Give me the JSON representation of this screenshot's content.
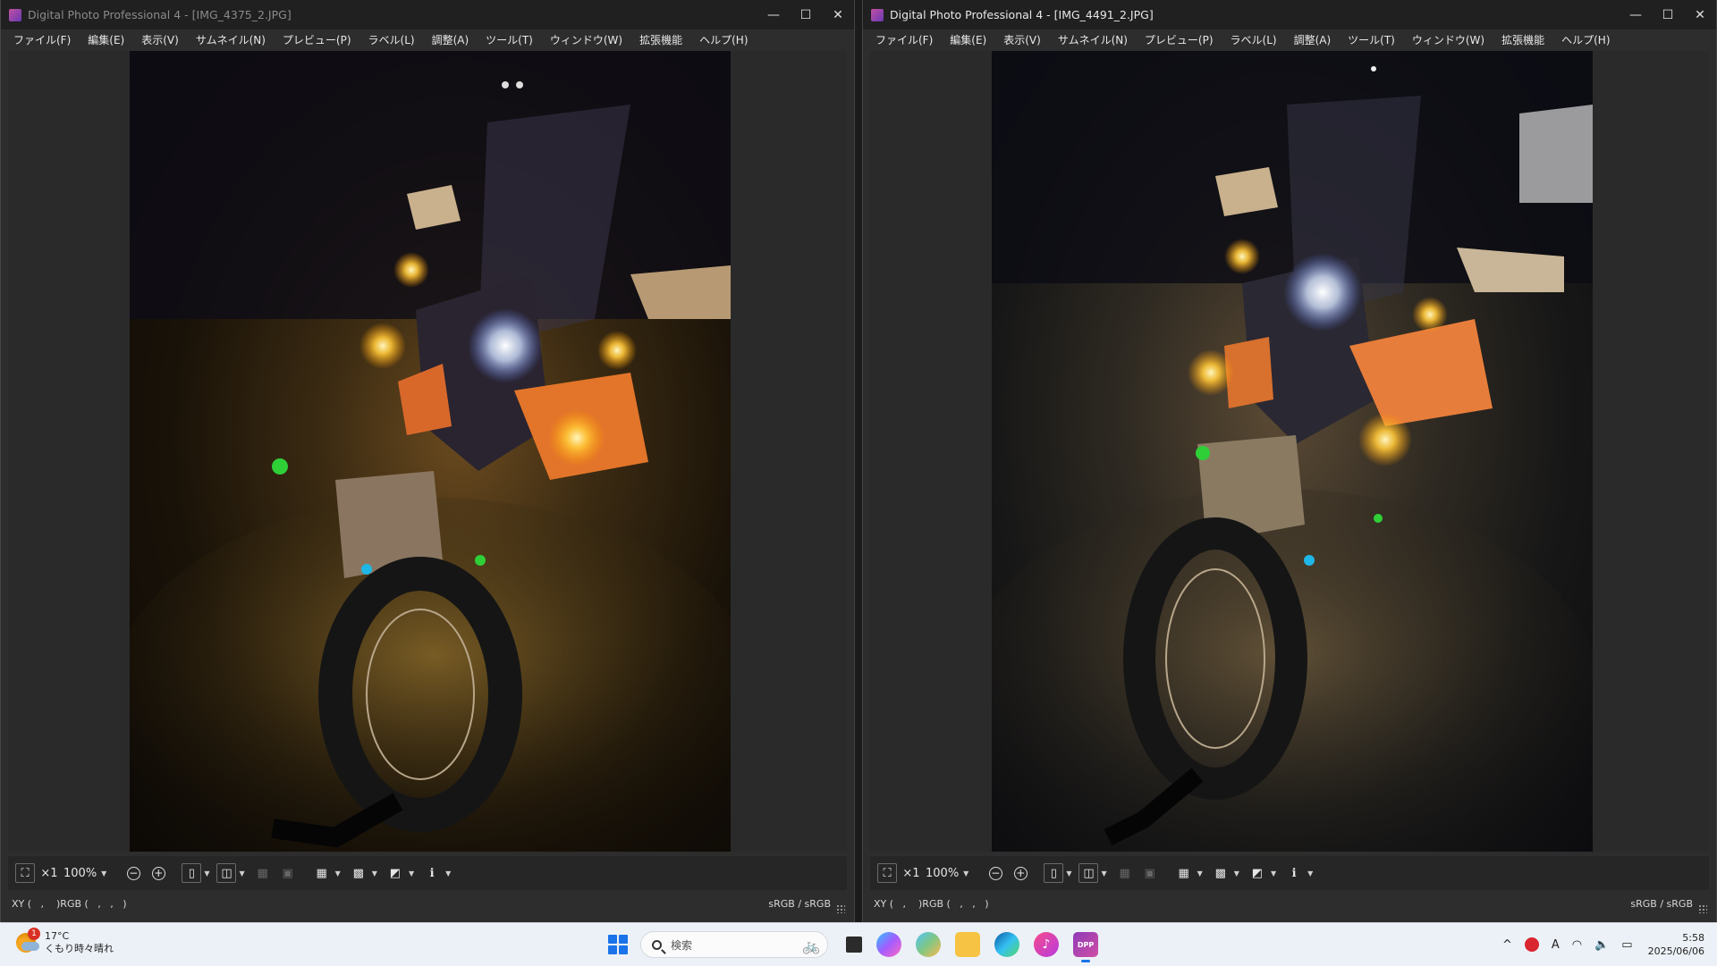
{
  "windows": [
    {
      "title": "Digital Photo Professional 4 - [IMG_4375_2.JPG]",
      "menu": [
        "ファイル(F)",
        "編集(E)",
        "表示(V)",
        "サムネイル(N)",
        "プレビュー(P)",
        "ラベル(L)",
        "調整(A)",
        "ツール(T)",
        "ウィンドウ(W)",
        "拡張機能",
        "ヘルプ(H)"
      ],
      "toolbar": {
        "ratio": "×1",
        "zoom": "100%"
      },
      "status": {
        "readout": "XY (   ,    )RGB (   ,   ,   )",
        "color_space": "sRGB / sRGB"
      }
    },
    {
      "title": "Digital Photo Professional 4 - [IMG_4491_2.JPG]",
      "menu": [
        "ファイル(F)",
        "編集(E)",
        "表示(V)",
        "サムネイル(N)",
        "プレビュー(P)",
        "ラベル(L)",
        "調整(A)",
        "ツール(T)",
        "ウィンドウ(W)",
        "拡張機能",
        "ヘルプ(H)"
      ],
      "toolbar": {
        "ratio": "×1",
        "zoom": "100%"
      },
      "status": {
        "readout": "XY (   ,    )RGB (   ,   ,   )",
        "color_space": "sRGB / sRGB"
      }
    }
  ],
  "window_controls": {
    "minimize": "—",
    "maximize": "☐",
    "close": "✕"
  },
  "taskbar": {
    "weather": {
      "badge": "1",
      "temp": "17°C",
      "desc": "くもり時々晴れ"
    },
    "search_placeholder": "検索",
    "apps": [
      "file-explorer",
      "copilot",
      "photos",
      "folder",
      "edge",
      "itunes",
      "dpp"
    ],
    "dpp_label": "DPP",
    "tray": {
      "chevron": "^",
      "ime": "A"
    },
    "clock": {
      "time": "5:58",
      "date": "2025/06/06"
    }
  },
  "colors": {
    "window_bg": "#2d2d2d",
    "titlebar_bg": "#202020",
    "taskbar_bg": "#ecf1f7",
    "accent": "#1a73e8"
  }
}
